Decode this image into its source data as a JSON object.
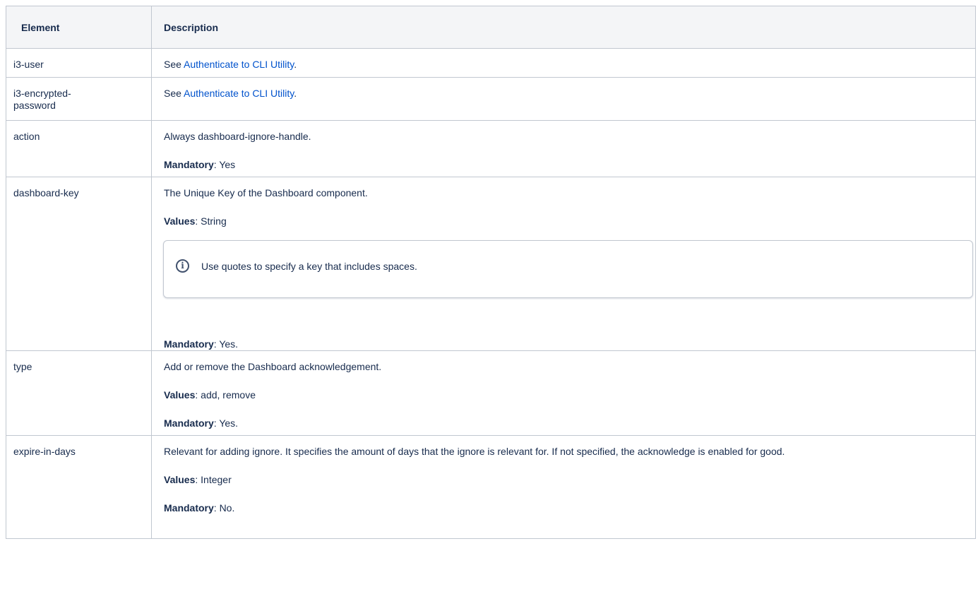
{
  "headers": {
    "element": "Element",
    "description": "Description"
  },
  "rows": [
    {
      "name": "i3-user",
      "see_prefix": "See ",
      "link": "Authenticate to CLI Utility",
      "see_suffix": "."
    },
    {
      "name": "i3-encrypted-\npassword",
      "see_prefix": "See ",
      "link": "Authenticate to CLI Utility",
      "see_suffix": "."
    },
    {
      "name": "action",
      "text": "Always dashboard-ignore-handle.",
      "mandatory_label": "Mandatory",
      "mandatory_value": ": Yes"
    },
    {
      "name": "dashboard-key",
      "text": "The Unique Key of the Dashboard component.",
      "values_label": "Values",
      "values_value": ": String",
      "info": {
        "icon": "info-icon",
        "text": "Use quotes to specify a key that includes spaces."
      },
      "mandatory_label": "Mandatory",
      "mandatory_value": ": Yes."
    },
    {
      "name": "type",
      "text": "Add or remove the Dashboard acknowledgement.",
      "values_label": "Values",
      "values_value": ": add, remove",
      "mandatory_label": "Mandatory",
      "mandatory_value": ": Yes."
    },
    {
      "name": "expire-in-days",
      "text": "Relevant for adding ignore. It specifies the amount of days that the ignore is relevant for. If not specified, the acknowledge is enabled for good.",
      "values_label": "Values",
      "values_value": ": Integer",
      "mandatory_label": "Mandatory",
      "mandatory_value": ": No."
    }
  ],
  "colors": {
    "link": "#0052cc",
    "border": "#c1c7d0",
    "header_bg": "#f4f5f7"
  }
}
